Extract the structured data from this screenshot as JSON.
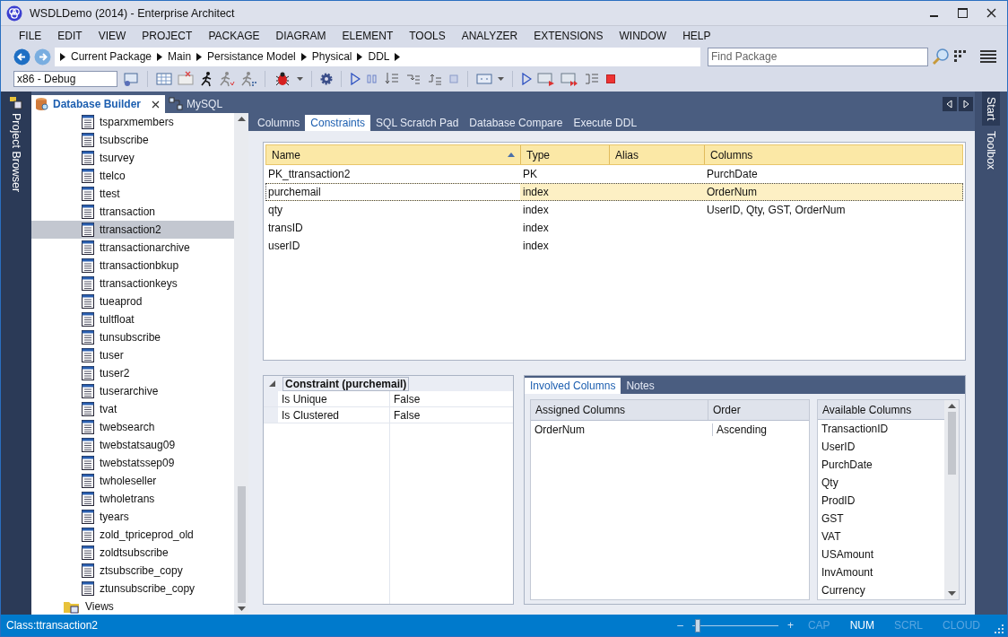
{
  "window": {
    "title": "WSDLDemo (2014) - Enterprise Architect"
  },
  "menu": [
    "FILE",
    "EDIT",
    "VIEW",
    "PROJECT",
    "PACKAGE",
    "DIAGRAM",
    "ELEMENT",
    "TOOLS",
    "ANALYZER",
    "EXTENSIONS",
    "WINDOW",
    "HELP"
  ],
  "navigation": {
    "breadcrumbs": [
      "Current Package",
      "Main",
      "Persistance Model",
      "Physical",
      "DDL"
    ],
    "search": {
      "placeholder": "Find Package"
    }
  },
  "toolbar": {
    "configuration": "x86 - Debug"
  },
  "side_tabs_left": [
    "Project Browser"
  ],
  "side_tabs_right": [
    "Start",
    "Toolbox"
  ],
  "dock_tabs": [
    {
      "label": "Database Builder",
      "selected": true,
      "closable": true
    },
    {
      "label": "MySQL",
      "selected": false,
      "closable": false
    }
  ],
  "tree": [
    {
      "label": "tsparxmembers",
      "kind": "table",
      "selected": false
    },
    {
      "label": "tsubscribe",
      "kind": "table",
      "selected": false
    },
    {
      "label": "tsurvey",
      "kind": "table",
      "selected": false
    },
    {
      "label": "ttelco",
      "kind": "table",
      "selected": false
    },
    {
      "label": "ttest",
      "kind": "table",
      "selected": false
    },
    {
      "label": "ttransaction",
      "kind": "table",
      "selected": false
    },
    {
      "label": "ttransaction2",
      "kind": "table",
      "selected": true
    },
    {
      "label": "ttransactionarchive",
      "kind": "table",
      "selected": false
    },
    {
      "label": "ttransactionbkup",
      "kind": "table",
      "selected": false
    },
    {
      "label": "ttransactionkeys",
      "kind": "table",
      "selected": false
    },
    {
      "label": "tueaprod",
      "kind": "table",
      "selected": false
    },
    {
      "label": "tultfloat",
      "kind": "table",
      "selected": false
    },
    {
      "label": "tunsubscribe",
      "kind": "table",
      "selected": false
    },
    {
      "label": "tuser",
      "kind": "table",
      "selected": false
    },
    {
      "label": "tuser2",
      "kind": "table",
      "selected": false
    },
    {
      "label": "tuserarchive",
      "kind": "table",
      "selected": false
    },
    {
      "label": "tvat",
      "kind": "table",
      "selected": false
    },
    {
      "label": "twebsearch",
      "kind": "table",
      "selected": false
    },
    {
      "label": "twebstatsaug09",
      "kind": "table",
      "selected": false
    },
    {
      "label": "twebstatssep09",
      "kind": "table",
      "selected": false
    },
    {
      "label": "twholeseller",
      "kind": "table",
      "selected": false
    },
    {
      "label": "twholetrans",
      "kind": "table",
      "selected": false
    },
    {
      "label": "tyears",
      "kind": "table",
      "selected": false
    },
    {
      "label": "zold_tpriceprod_old",
      "kind": "table",
      "selected": false
    },
    {
      "label": "zoldtsubscribe",
      "kind": "table",
      "selected": false
    },
    {
      "label": "ztsubscribe_copy",
      "kind": "table",
      "selected": false
    },
    {
      "label": "ztunsubscribe_copy",
      "kind": "table",
      "selected": false
    },
    {
      "label": "Views",
      "kind": "folder",
      "selected": false
    }
  ],
  "builder": {
    "tabs": [
      {
        "label": "Columns",
        "selected": false
      },
      {
        "label": "Constraints",
        "selected": true
      },
      {
        "label": "SQL Scratch Pad",
        "selected": false
      },
      {
        "label": "Database Compare",
        "selected": false
      },
      {
        "label": "Execute DDL",
        "selected": false
      }
    ],
    "constraints": {
      "columns": [
        {
          "label": "Name",
          "sorted": true
        },
        {
          "label": "Type",
          "sorted": false
        },
        {
          "label": "Alias",
          "sorted": false
        },
        {
          "label": "Columns",
          "sorted": false
        }
      ],
      "rows": [
        {
          "cells": [
            "PK_ttransaction2",
            "PK",
            "",
            "PurchDate"
          ],
          "selected": false
        },
        {
          "cells": [
            "purchemail",
            "index",
            "",
            "OrderNum"
          ],
          "selected": true
        },
        {
          "cells": [
            "qty",
            "index",
            "",
            "UserID, Qty, GST, OrderNum"
          ],
          "selected": false
        },
        {
          "cells": [
            "transID",
            "index",
            "",
            ""
          ],
          "selected": false
        },
        {
          "cells": [
            "userID",
            "index",
            "",
            ""
          ],
          "selected": false
        }
      ]
    },
    "properties": {
      "heading": "Constraint (purchemail)",
      "expanded": true,
      "rows": [
        {
          "name": "Is Unique",
          "value": "False"
        },
        {
          "name": "Is Clustered",
          "value": "False"
        }
      ]
    },
    "detail_tabs": [
      {
        "label": "Involved Columns",
        "selected": true
      },
      {
        "label": "Notes",
        "selected": false
      }
    ],
    "assigned": {
      "columns": [
        "Assigned Columns",
        "Order"
      ],
      "rows": [
        [
          "OrderNum",
          "Ascending"
        ]
      ]
    },
    "available": {
      "heading": "Available Columns",
      "items": [
        "TransactionID",
        "UserID",
        "PurchDate",
        "Qty",
        "ProdID",
        "GST",
        "VAT",
        "USAmount",
        "InvAmount",
        "Currency"
      ]
    }
  },
  "status_bar": {
    "text": "Class:ttransaction2",
    "zoom_out": "–",
    "zoom_in": "+",
    "zoom": {
      "level": 0.03
    },
    "indicators": [
      {
        "label": "CAP",
        "on": false
      },
      {
        "label": "NUM",
        "on": true
      },
      {
        "label": "SCRL",
        "on": false
      },
      {
        "label": "CLOUD",
        "on": false
      }
    ]
  }
}
